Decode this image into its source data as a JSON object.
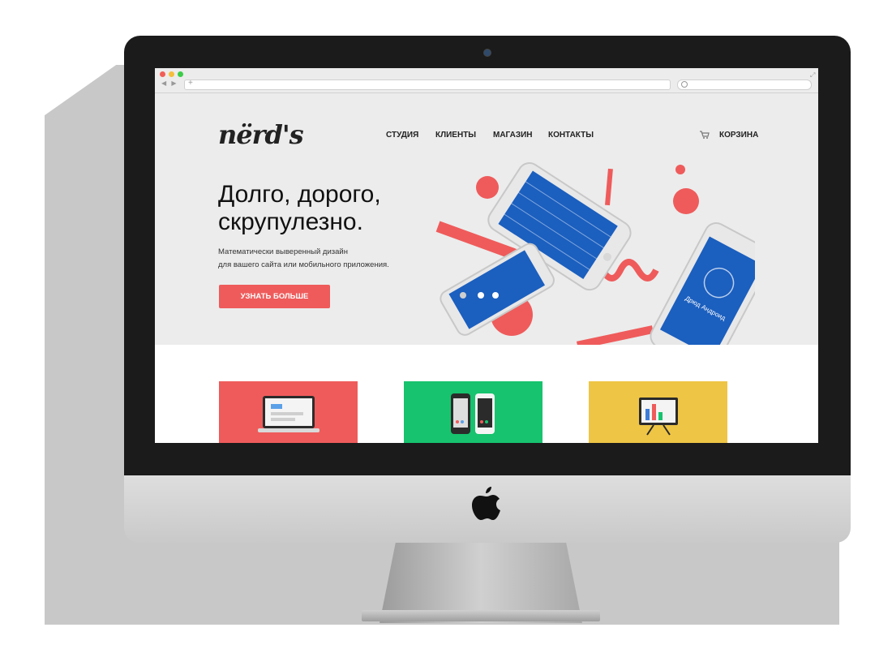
{
  "browser": {
    "nav_arrows": "◀ ▶",
    "address_plus": "+"
  },
  "site": {
    "logo": "nërd's",
    "nav": [
      "СТУДИЯ",
      "КЛИЕНТЫ",
      "МАГАЗИН",
      "КОНТАКТЫ"
    ],
    "cart_label": "КОРЗИНА",
    "headline_line1": "Долго, дорого,",
    "headline_line2": "скрупулезно.",
    "subtitle_line1": "Математически выверенный дизайн",
    "subtitle_line2": "для вашего сайта или мобильного приложения.",
    "cta_label": "УЗНАТЬ БОЛЬШЕ",
    "phone_caption": "Дрюд Андроид"
  },
  "colors": {
    "accent": "#ef5b5b",
    "card1": "#ef5b5b",
    "card2": "#17c36e",
    "card3": "#eec545",
    "phone_blue": "#1b5fbf"
  },
  "icons": [
    "apple-logo-icon",
    "cart-icon",
    "search-icon",
    "laptop-icon",
    "phones-icon",
    "presentation-board-icon"
  ]
}
